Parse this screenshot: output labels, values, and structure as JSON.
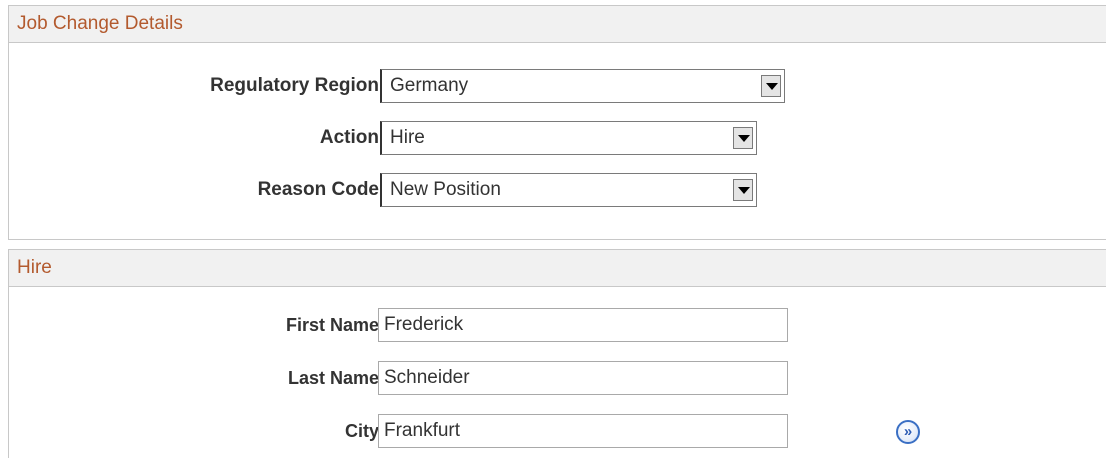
{
  "job_change_details": {
    "title": "Job Change Details",
    "fields": {
      "regulatory_region": {
        "label": "Regulatory Region",
        "value": "Germany"
      },
      "action": {
        "label": "Action",
        "value": "Hire"
      },
      "reason_code": {
        "label": "Reason Code",
        "value": "New Position"
      }
    }
  },
  "hire": {
    "title": "Hire",
    "fields": {
      "first_name": {
        "label": "First Name",
        "value": "Frederick"
      },
      "last_name": {
        "label": "Last Name",
        "value": "Schneider"
      },
      "city": {
        "label": "City",
        "value": "Frankfurt"
      }
    },
    "lookup_glyph": "»",
    "lookup_icon": "double-chevron-right-icon"
  },
  "colors": {
    "section_header_text": "#b35a2e",
    "section_header_bg": "#f1f1f1",
    "lookup_icon_blue": "#3a6fc4"
  }
}
